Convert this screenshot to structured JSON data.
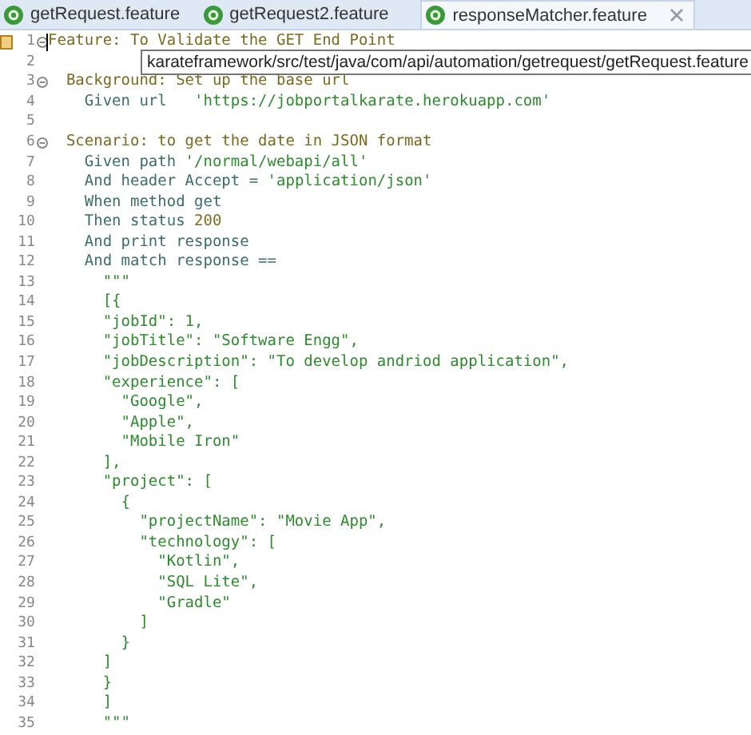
{
  "tabs": [
    {
      "label": "getRequest.feature",
      "selected": false
    },
    {
      "label": "getRequest2.feature",
      "selected": false
    },
    {
      "label": "responseMatcher.feature",
      "selected": true,
      "closable": true
    }
  ],
  "tooltip": "karateframework/src/test/java/com/api/automation/getrequest/getRequest.feature",
  "lines": [
    {
      "number": "1",
      "fold": true,
      "warning": true,
      "cursor": true,
      "segments": [
        {
          "kind": "keyword",
          "text": "Feature: To Validate the GET End Point"
        }
      ]
    },
    {
      "number": "2"
    },
    {
      "number": "3",
      "fold": true,
      "segments": [
        {
          "kind": "keyword",
          "text": "  Background: Set up the base url"
        }
      ]
    },
    {
      "number": "4",
      "segments": [
        {
          "kind": "step",
          "text": "    Given url   "
        },
        {
          "kind": "string",
          "text": "'https://jobportalkarate.herokuapp.com'"
        }
      ]
    },
    {
      "number": "5"
    },
    {
      "number": "6",
      "fold": true,
      "segments": [
        {
          "kind": "keyword",
          "text": "  Scenario: to get the date in JSON format"
        }
      ]
    },
    {
      "number": "7",
      "segments": [
        {
          "kind": "step",
          "text": "    Given path "
        },
        {
          "kind": "string",
          "text": "'/normal/webapi/all'"
        }
      ]
    },
    {
      "number": "8",
      "segments": [
        {
          "kind": "step",
          "text": "    And header Accept = "
        },
        {
          "kind": "string",
          "text": "'application/json'"
        }
      ]
    },
    {
      "number": "9",
      "segments": [
        {
          "kind": "step",
          "text": "    When method get"
        }
      ]
    },
    {
      "number": "10",
      "segments": [
        {
          "kind": "step",
          "text": "    Then status "
        },
        {
          "kind": "number",
          "text": "200"
        }
      ]
    },
    {
      "number": "11",
      "segments": [
        {
          "kind": "step",
          "text": "    And print response"
        }
      ]
    },
    {
      "number": "12",
      "segments": [
        {
          "kind": "step",
          "text": "    And match response =="
        }
      ]
    },
    {
      "number": "13",
      "segments": [
        {
          "kind": "string",
          "text": "      \"\"\""
        }
      ]
    },
    {
      "number": "14",
      "segments": [
        {
          "kind": "string",
          "text": "      [{"
        }
      ]
    },
    {
      "number": "15",
      "segments": [
        {
          "kind": "string",
          "text": "      \"jobId\": 1,"
        }
      ]
    },
    {
      "number": "16",
      "segments": [
        {
          "kind": "string",
          "text": "      \"jobTitle\": \"Software Engg\","
        }
      ]
    },
    {
      "number": "17",
      "segments": [
        {
          "kind": "string",
          "text": "      \"jobDescription\": \"To develop andriod application\","
        }
      ]
    },
    {
      "number": "18",
      "segments": [
        {
          "kind": "string",
          "text": "      \"experience\": ["
        }
      ]
    },
    {
      "number": "19",
      "segments": [
        {
          "kind": "string",
          "text": "        \"Google\","
        }
      ]
    },
    {
      "number": "20",
      "segments": [
        {
          "kind": "string",
          "text": "        \"Apple\","
        }
      ]
    },
    {
      "number": "21",
      "segments": [
        {
          "kind": "string",
          "text": "        \"Mobile Iron\""
        }
      ]
    },
    {
      "number": "22",
      "segments": [
        {
          "kind": "string",
          "text": "      ],"
        }
      ]
    },
    {
      "number": "23",
      "segments": [
        {
          "kind": "string",
          "text": "      \"project\": ["
        }
      ]
    },
    {
      "number": "24",
      "segments": [
        {
          "kind": "string",
          "text": "        {"
        }
      ]
    },
    {
      "number": "25",
      "segments": [
        {
          "kind": "string",
          "text": "          \"projectName\": \"Movie App\","
        }
      ]
    },
    {
      "number": "26",
      "segments": [
        {
          "kind": "string",
          "text": "          \"technology\": ["
        }
      ]
    },
    {
      "number": "27",
      "segments": [
        {
          "kind": "string",
          "text": "            \"Kotlin\","
        }
      ]
    },
    {
      "number": "28",
      "segments": [
        {
          "kind": "string",
          "text": "            \"SQL Lite\","
        }
      ]
    },
    {
      "number": "29",
      "segments": [
        {
          "kind": "string",
          "text": "            \"Gradle\""
        }
      ]
    },
    {
      "number": "30",
      "segments": [
        {
          "kind": "string",
          "text": "          ]"
        }
      ]
    },
    {
      "number": "31",
      "segments": [
        {
          "kind": "string",
          "text": "        }"
        }
      ]
    },
    {
      "number": "32",
      "segments": [
        {
          "kind": "string",
          "text": "      ]"
        }
      ]
    },
    {
      "number": "33",
      "segments": [
        {
          "kind": "string",
          "text": "      }"
        }
      ]
    },
    {
      "number": "34",
      "segments": [
        {
          "kind": "string",
          "text": "      ]"
        }
      ]
    },
    {
      "number": "35",
      "segments": [
        {
          "kind": "string",
          "text": "      \"\"\""
        }
      ]
    }
  ]
}
